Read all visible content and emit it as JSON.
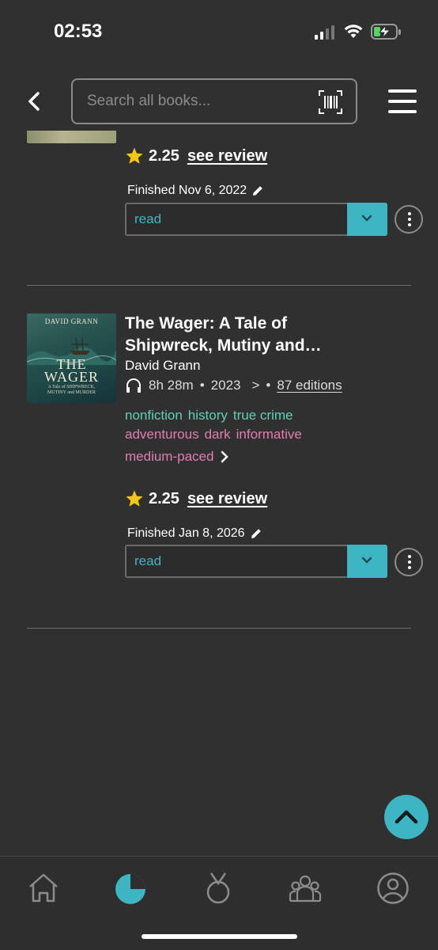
{
  "status_bar": {
    "time": "02:53"
  },
  "header": {
    "search_placeholder": "Search all books...",
    "icons": [
      "back-chevron-icon",
      "barcode-scan-icon",
      "hamburger-menu-icon"
    ]
  },
  "books": [
    {
      "rating": "2.25",
      "review_link": "see review",
      "finished": "Finished Nov 6, 2022",
      "status": "read"
    },
    {
      "cover_author": "DAVID GRANN",
      "cover_title_line1": "THE",
      "cover_title_line2": "WAGER",
      "cover_subtitle_line1": "A Tale of SHIPWRECK,",
      "cover_subtitle_line2": "MUTINY and MURDER",
      "title": "The Wager: A Tale of Shipwreck, Mutiny and…",
      "author": "David Grann",
      "duration": "8h 28m",
      "separator": "•",
      "year": "2023",
      "chevron": ">",
      "editions": "87 editions",
      "genres": [
        "nonfiction",
        "history",
        "true crime"
      ],
      "moods": [
        "adventurous",
        "dark",
        "informative"
      ],
      "pace": "medium-paced",
      "rating": "2.25",
      "review_link": "see review",
      "finished": "Finished Jan 8, 2026",
      "status": "read"
    }
  ],
  "tab_bar": {
    "tabs": [
      "home-icon",
      "stats-pie-icon",
      "medal-icon",
      "community-icon",
      "profile-icon"
    ],
    "active": "stats-pie-icon"
  },
  "colors": {
    "background": "#303030",
    "accent": "#3bb6c2",
    "genre": "#5fd0b5",
    "mood": "#e07eb0",
    "star": "#f5c518"
  }
}
